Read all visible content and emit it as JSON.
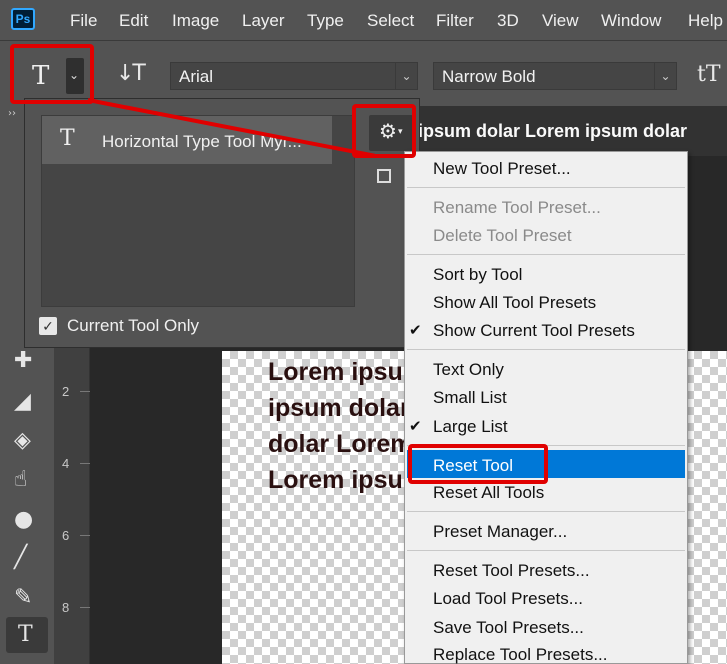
{
  "menubar": {
    "logo": "Ps",
    "items": [
      "File",
      "Edit",
      "Image",
      "Layer",
      "Type",
      "Select",
      "Filter",
      "3D",
      "View",
      "Window",
      "Help"
    ]
  },
  "options_bar": {
    "tool_glyph": "T",
    "orient_glyph": "↓T",
    "font_family": "Arial",
    "font_style": "Narrow Bold",
    "size_glyph": "tT"
  },
  "toolbar": {
    "icons": [
      "bandage-icon",
      "eraser-icon",
      "paint-bucket-icon",
      "smudge-icon",
      "dodge-icon",
      "line-icon",
      "eyedropper-icon",
      "type-icon"
    ]
  },
  "ruler": {
    "labels": [
      "2",
      "4",
      "6",
      "8"
    ]
  },
  "document": {
    "tab_text": "m ipsum dolar Lorem ipsum dolar",
    "lines": [
      "Lorem ipsu",
      "ipsum dolar",
      "dolar Lorem",
      "Lorem ipsu"
    ]
  },
  "preset_panel": {
    "item_label": "Horizontal Type Tool Myr...",
    "current_tool_only": "Current Tool Only"
  },
  "context_menu": {
    "groups": [
      [
        {
          "label": "New Tool Preset...",
          "enabled": true,
          "checked": false
        }
      ],
      [
        {
          "label": "Rename Tool Preset...",
          "enabled": false,
          "checked": false
        },
        {
          "label": "Delete Tool Preset",
          "enabled": false,
          "checked": false
        }
      ],
      [
        {
          "label": "Sort by Tool",
          "enabled": true,
          "checked": false
        },
        {
          "label": "Show All Tool Presets",
          "enabled": true,
          "checked": false
        },
        {
          "label": "Show Current Tool Presets",
          "enabled": true,
          "checked": true
        }
      ],
      [
        {
          "label": "Text Only",
          "enabled": true,
          "checked": false
        },
        {
          "label": "Small List",
          "enabled": true,
          "checked": false
        },
        {
          "label": "Large List",
          "enabled": true,
          "checked": true
        }
      ],
      [
        {
          "label": "Reset Tool",
          "enabled": true,
          "checked": false,
          "highlighted": true
        },
        {
          "label": "Reset All Tools",
          "enabled": true,
          "checked": false
        }
      ],
      [
        {
          "label": "Preset Manager...",
          "enabled": true,
          "checked": false
        }
      ],
      [
        {
          "label": "Reset Tool Presets...",
          "enabled": true,
          "checked": false
        },
        {
          "label": "Load Tool Presets...",
          "enabled": true,
          "checked": false
        },
        {
          "label": "Save Tool Presets...",
          "enabled": true,
          "checked": false
        },
        {
          "label": "Replace Tool Presets...",
          "enabled": true,
          "checked": false
        }
      ]
    ]
  },
  "colors": {
    "highlight": "#0078d7",
    "annotation": "#e00000",
    "panel": "#535353"
  }
}
